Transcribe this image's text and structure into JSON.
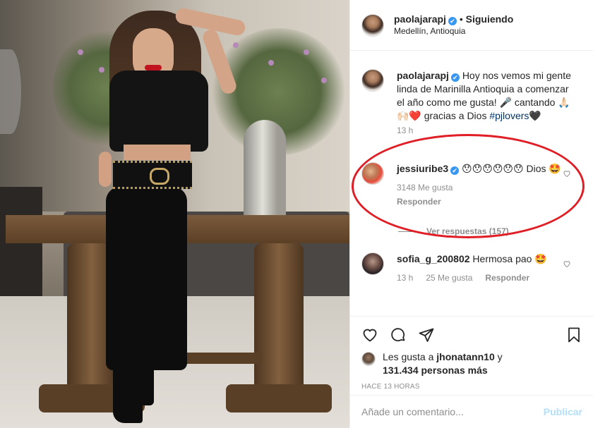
{
  "post": {
    "author": "paolajarapj",
    "verified_mark": "✔",
    "separator": "•",
    "follow_state": "Siguiendo",
    "location": "Medellín, Antioquia"
  },
  "caption": {
    "author": "paolajarapj",
    "text_1": "Hoy nos vemos mi gente linda de Marinilla Antioquia a comenzar el año como me gusta! 🎤 cantando 🙏🏻🙌🏻❤️ gracias a Dios ",
    "hashtag": "#pjlovers",
    "text_2": "🖤",
    "time": "13 h"
  },
  "comments": [
    {
      "author": "jessiuribe3",
      "text": "😯😯😯😯😯😯 Dios 🤩",
      "likes": "3148 Me gusta",
      "reply_label": "Responder",
      "view_replies": "Ver respuestas (157)"
    },
    {
      "author": "sofia_g_200802",
      "text": "Hermosa pao 🤩",
      "time": "13 h",
      "likes": "25 Me gusta",
      "reply_label": "Responder"
    }
  ],
  "likes": {
    "prefix": "Les gusta a ",
    "user": "jhonatann10",
    "middle": " y ",
    "others": "131.434 personas más"
  },
  "time_ago": "HACE 13 HORAS",
  "add_comment": {
    "placeholder": "Añade un comentario...",
    "publish": "Publicar"
  },
  "icons": [
    "heart-icon",
    "comment-icon",
    "share-icon",
    "bookmark-icon"
  ],
  "colors": {
    "link": "#003569",
    "verified": "#3897f0",
    "highlight": "#e01e26",
    "muted": "#8e8e8e",
    "publish_disabled": "#b2dffc"
  }
}
